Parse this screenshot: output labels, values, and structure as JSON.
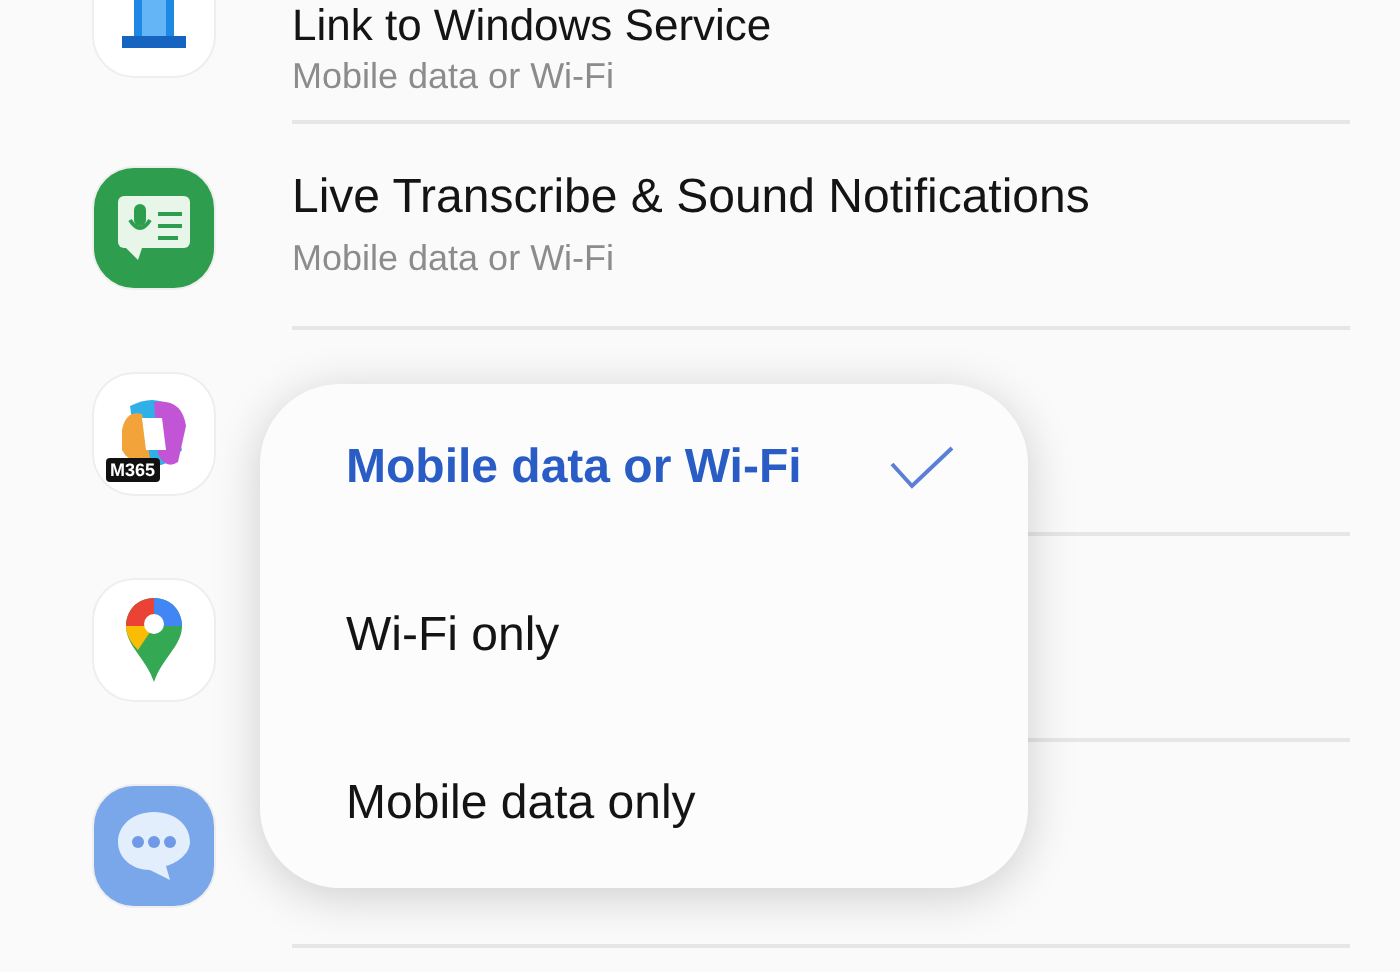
{
  "apps": [
    {
      "kind": "building",
      "title": "Link to Windows Service",
      "subtitle": "Mobile data or Wi-Fi"
    },
    {
      "kind": "transcript",
      "title": "Live Transcribe & Sound Notifications",
      "subtitle": "Mobile data or Wi-Fi"
    },
    {
      "kind": "swirl",
      "icon_label": "M365"
    },
    {
      "kind": "pin"
    },
    {
      "kind": "chat"
    }
  ],
  "menu": [
    {
      "label": "Mobile data or Wi-Fi",
      "selected": true
    },
    {
      "label": "Wi-Fi only",
      "selected": false
    },
    {
      "label": "Mobile data only",
      "selected": false
    }
  ]
}
